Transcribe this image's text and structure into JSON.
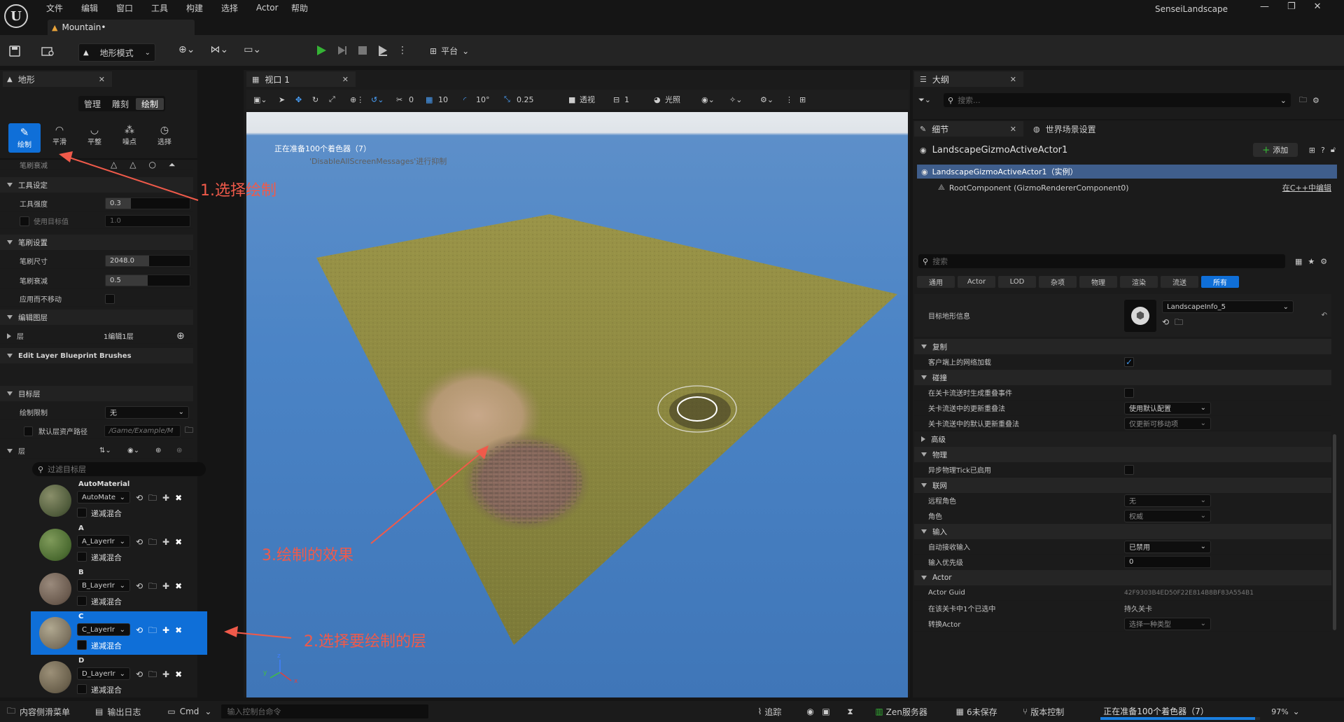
{
  "app": {
    "project_name": "SenseiLandscape",
    "level_tab": "Mountain•"
  },
  "menu": [
    "文件",
    "编辑",
    "窗口",
    "工具",
    "构建",
    "选择",
    "Actor",
    "帮助"
  ],
  "toolbar": {
    "mode": "地形模式",
    "platform": "平台"
  },
  "landscape_panel": {
    "title": "地形",
    "modes": [
      "管理",
      "雕刻",
      "绘制"
    ],
    "active_mode": "绘制",
    "tools": [
      "绘制",
      "平滑",
      "平整",
      "噪点",
      "选择"
    ],
    "sections": {
      "brush_falloff_label": "笔刷衰减",
      "tool_settings": "工具设定",
      "tool_strength_label": "工具强度",
      "tool_strength_value": "0.3",
      "use_target_label": "使用目标值",
      "use_target_value": "1.0",
      "brush_settings": "笔刷设置",
      "brush_size_label": "笔刷尺寸",
      "brush_size_value": "2048.0",
      "brush_falloff_value_label": "笔刷衰减",
      "brush_falloff_value": "0.5",
      "apply_no_move_label": "应用而不移动",
      "edit_layers": "编辑图层",
      "layer_label": "层",
      "layer_value": "1编辑1层",
      "bp_brushes": "Edit Layer Blueprint Brushes",
      "target_layers": "目标层",
      "paint_limit_label": "绘制限制",
      "paint_limit_value": "无",
      "default_layer_path_label": "默认层资产路径",
      "default_layer_path_value": "/Game/Example/M",
      "layers_label": "层",
      "filter_placeholder": "过滤目标层"
    },
    "layers": [
      {
        "name": "AutoMaterial",
        "info": "AutoMate",
        "blend": "递减混合"
      },
      {
        "name": "A",
        "info": "A_LayerIr",
        "blend": "递减混合"
      },
      {
        "name": "B",
        "info": "B_LayerIr",
        "blend": "递减混合"
      },
      {
        "name": "C",
        "info": "C_LayerIr",
        "blend": "递减混合"
      },
      {
        "name": "D",
        "info": "D_LayerIr",
        "blend": "递减混合"
      }
    ]
  },
  "viewport": {
    "tab": "视口 1",
    "snap_angle": "10°",
    "snap_grid": "10",
    "snap_scale": "0.25",
    "camera_speed": "1",
    "rotate_value": "0",
    "view_mode": "透视",
    "lighting": "光照",
    "message1": "正在准备100个着色器（7）",
    "message2": "'DisableAllScreenMessages'进行抑制"
  },
  "annotations": {
    "a1": "1.选择绘制",
    "a2": "2.选择要绘制的层",
    "a3": "3.绘制的效果"
  },
  "outliner": {
    "title": "大纲",
    "search_placeholder": "搜索..."
  },
  "details": {
    "tab": "细节",
    "world_tab": "世界场景设置",
    "actor_name": "LandscapeGizmoActiveActor1",
    "add_label": "添加",
    "instance_label": "LandscapeGizmoActiveActor1（实例）",
    "root_component": "RootComponent (GizmoRendererComponent0)",
    "edit_cpp": "在C++中编辑",
    "search_placeholder": "搜索",
    "filters": [
      "通用",
      "Actor",
      "LOD",
      "杂项",
      "物理",
      "渲染",
      "流送",
      "所有"
    ],
    "active_filter": "所有",
    "target_landscape_label": "目标地形信息",
    "target_landscape_value": "LandscapeInfo_5",
    "s_replication": "复制",
    "net_load_label": "客户端上的网络加载",
    "s_collision": "碰撞",
    "gen_overlap_label": "在关卡流送时生成重叠事件",
    "update_overlap_label": "关卡流送中的更新重叠法",
    "update_overlap_value": "使用默认配置",
    "default_overlap_label": "关卡流送中的默认更新重叠法",
    "default_overlap_value": "仅更新可移动项",
    "s_advanced": "高级",
    "s_physics": "物理",
    "async_tick_label": "异步物理Tick已启用",
    "s_network": "联网",
    "remote_role_label": "远程角色",
    "remote_role_value": "无",
    "role_label": "角色",
    "role_value": "权威",
    "s_input": "输入",
    "auto_input_label": "自动接收输入",
    "auto_input_value": "已禁用",
    "input_priority_label": "输入优先级",
    "input_priority_value": "0",
    "s_actor": "Actor",
    "guid_label": "Actor Guid",
    "guid_value": "42F9303B4ED50F22E814B8BF83A554B1",
    "selected_in_label": "在该关卡中1个已选中",
    "selected_in_value": "持久关卡",
    "convert_actor_label": "转换Actor",
    "convert_actor_value": "选择一种类型"
  },
  "statusbar": {
    "content_drawer": "内容侧滑菜单",
    "output_log": "输出日志",
    "cmd": "Cmd",
    "console_placeholder": "输入控制台命令",
    "trace": "追踪",
    "zen": "Zen服务器",
    "unsaved": "6未保存",
    "source_control": "版本控制",
    "shader_progress": "正在准备100个着色器（7）",
    "progress_pct": "97%"
  },
  "colors": {
    "accent": "#0f6fd8",
    "play_green": "#35b335",
    "annotation_red": "#f05a4a"
  }
}
